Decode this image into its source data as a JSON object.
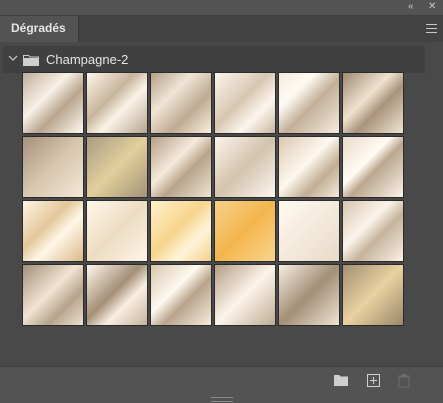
{
  "panel": {
    "tab_label": "Dégradés",
    "group_name": "Champagne-2"
  },
  "icons": {
    "collapse": "double-chevron-left-icon",
    "close": "close-icon",
    "menu": "hamburger-menu-icon",
    "new_group": "folder-icon",
    "new_gradient": "add-icon",
    "delete": "trash-icon"
  },
  "colors": {
    "panel_bg": "#535353",
    "content_bg": "#494949",
    "header_bg": "#404040"
  },
  "gradients": [
    "linear-gradient(135deg,#bfae99 0%,#f8f1e6 38%,#b9a58f 62%,#fffaf2 100%)",
    "linear-gradient(135deg,#fff6ec 0%,#c7b49c 40%,#fbf3e7 60%,#b7a58f 100%)",
    "linear-gradient(135deg,#b5a087 0%,#efe5d6 35%,#bfaa92 65%,#f9efe0 100%)",
    "linear-gradient(135deg,#fbf5ec 0%,#d7c7b2 45%,#fcf6ee 70%,#c9b7a1 100%)",
    "linear-gradient(135deg,#f4ebde 0%,#fffaf3 30%,#c2af98 55%,#f6ecdf 100%)",
    "linear-gradient(135deg,#9f8a72 0%,#efe2cf 40%,#a9937b 60%,#f1e5d3 100%)",
    "linear-gradient(135deg,#a6917b 0%,#d8c6ae 50%,#f3e8d8 100%)",
    "linear-gradient(135deg,#a99c83 0%,#e2cf9c 50%,#a39378 100%)",
    "linear-gradient(135deg,#b49f86 0%,#f4eadb 40%,#b8a48c 60%,#efe3d2 100%)",
    "linear-gradient(135deg,#fbf4ea 0%,#d4c3ad 50%,#fcf7f0 100%)",
    "linear-gradient(135deg,#d9c8b2 0%,#fff8ee 45%,#c1ad94 70%,#f6ecdd 100%)",
    "linear-gradient(135deg,#e9dccb 0%,#fffaf3 40%,#bba78f 55%,#fbf3e8 100%)",
    "linear-gradient(135deg,#fff3e2 0%,#e3c79a 40%,#fff6e8 60%,#dab98a 100%)",
    "linear-gradient(135deg,#fff7ec 0%,#eddcc2 50%,#fdf4e7 100%)",
    "linear-gradient(135deg,#fff0cc 0%,#f7d58c 45%,#fff4d9 70%,#f3d18c 100%)",
    "linear-gradient(135deg,#f7d08a 0%,#f3b64e 50%,#f9d48f 100%)",
    "linear-gradient(135deg,#fffaf2 0%,#f4eadc 50%,#e8dac8 100%)",
    "linear-gradient(135deg,#d7c6b1 0%,#fcf4ea 40%,#c6b39c 60%,#fbf1e4 100%)",
    "linear-gradient(135deg,#a28f7a 0%,#f1e4d2 45%,#b6a38c 70%,#efe2d0 100%)",
    "linear-gradient(135deg,#fff7ed 0%,#a48f77 45%,#f9efe2 65%,#c6b29b 100%)",
    "linear-gradient(135deg,#d8c6af 0%,#fff9f0 40%,#b9a48c 60%,#f7ecdd 100%)",
    "linear-gradient(135deg,#b49e86 0%,#fcf4e9 50%,#bfab94 100%)",
    "linear-gradient(135deg,#f6ede1 0%,#a48f78 50%,#efe3d3 100%)",
    "linear-gradient(135deg,#a49074 0%,#e9d1a0 50%,#9b876c 100%)"
  ]
}
